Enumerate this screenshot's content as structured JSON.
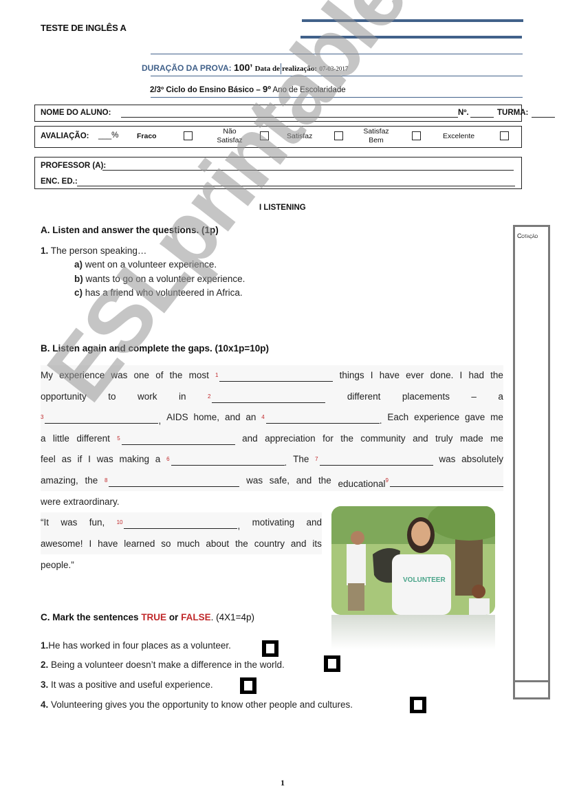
{
  "header": {
    "title": "TESTE DE INGLÊS A",
    "duration_label": "DURAÇÃO DA PROVA:",
    "duration_value": "100’",
    "date_label_a": "Data de",
    "date_label_b": "realização:",
    "date_value": "07-03-2017",
    "cycle_bold": "2/3º Ciclo do Ensino Básico – ",
    "grade_bold": "9º",
    "grade_rest": " Ano de Escolaridade"
  },
  "student_box": {
    "name_label": "NOME DO ALUNO:",
    "number_label": "Nº.",
    "class_label": "TURMA:"
  },
  "evaluation": {
    "label": "AVALIAÇÃO:",
    "percent": "___%",
    "options": [
      {
        "label": "Fraco",
        "checked": false
      },
      {
        "label": "Não Satisfaz",
        "checked": false
      },
      {
        "label": "Satisfaz",
        "checked": false
      },
      {
        "label": "Satisfaz Bem",
        "checked": false
      },
      {
        "label": "Excelente",
        "checked": false
      }
    ]
  },
  "teacher_box": {
    "teacher_label": "PROFESSOR (A):",
    "guardian_label": "ENC. ED.:"
  },
  "section_title": "I LISTENING",
  "side_column": {
    "label": "Cotação"
  },
  "part_a": {
    "heading": "A. Listen and answer the questions. (1p)",
    "question_num": "1.",
    "question": " The person speaking…",
    "options": [
      {
        "letter": "a)",
        "text": " went on a volunteer experience."
      },
      {
        "letter": "b)",
        "text": " wants to go on a volunteer experience."
      },
      {
        "letter": "c)",
        "text": " has a friend who volunteered in Africa."
      }
    ]
  },
  "part_b": {
    "heading": "B. Listen again and complete the gaps. (10x1p=10p)",
    "lines": [
      [
        "My",
        "experience",
        "was",
        "one",
        "of",
        "the",
        "most",
        "{1}",
        "things",
        "I",
        "have",
        "ever",
        "done.",
        "I",
        "had",
        "the"
      ],
      [
        "opportunity",
        "to",
        "work",
        "in",
        "{2}",
        "different",
        "placements",
        "–",
        "a"
      ],
      [
        "{3},",
        "AIDS",
        "home,",
        "and",
        "an",
        "{4}.",
        "Each",
        "experience",
        "gave",
        "me"
      ],
      [
        "a",
        "little",
        "different",
        "{5}",
        "and",
        "appreciation",
        "for",
        "the",
        "community",
        "and",
        "truly",
        "made",
        "me"
      ],
      [
        "feel",
        "as",
        "if",
        "I",
        "was",
        "making",
        "a",
        "{6}.",
        "The",
        "{7}",
        "was",
        "absolutely"
      ],
      [
        "amazing,",
        "the",
        "{8}",
        "was",
        "safe,",
        "and",
        "the",
        "educational{9}"
      ]
    ],
    "last_line": "were extraordinary.",
    "quote_lines": [
      [
        "“It",
        "was",
        "fun,",
        "{10},",
        "motivating",
        "and"
      ],
      [
        "awesome!",
        "I",
        "have",
        "learned",
        "so",
        "much",
        "about",
        "the",
        "country",
        "and",
        "its"
      ]
    ],
    "quote_end": "people.”"
  },
  "photo": {
    "description": "Smiling young woman in a white VOLUNTEER t-shirt holding a garbage bag in a park, with other volunteers in the background",
    "shirt_text": "VOLUNTEER"
  },
  "part_c": {
    "heading_a": "C. Mark the sentences ",
    "true_word": "TRUE",
    "or_word": " or ",
    "false_word": "FALSE",
    "heading_b": ". (4X1=4p)",
    "items": [
      {
        "num": "1.",
        "text": "He has worked in four places as a volunteer."
      },
      {
        "num": "2.",
        "text": " Being a volunteer doesn’t make a difference in the world."
      },
      {
        "num": "3.",
        "text": " It was a positive and useful experience."
      },
      {
        "num": "4.",
        "text": " Volunteering gives you the opportunity to know other people and cultures."
      }
    ]
  },
  "watermark": "ESLprintables.com",
  "page_number": "1",
  "colors": {
    "accent_blue": "#41618a",
    "answer_red": "#c0282a",
    "border_gray": "#7a7a7a"
  }
}
